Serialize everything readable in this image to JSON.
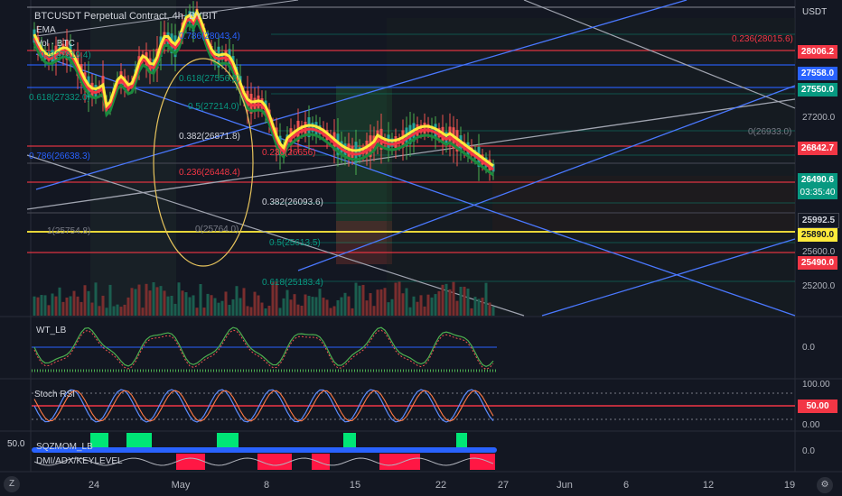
{
  "header": {
    "symbol": "BTCUSDT Perpetual Contract, 4h, BYBIT",
    "ema_label": "EMA",
    "vol_label": "Vol · BTC"
  },
  "currency": "USDT",
  "price_axis": [
    "27200.0",
    "25600.0",
    "25200.0"
  ],
  "price_tags": {
    "p28006": "28006.2",
    "p27558": "27558.0",
    "p27550": "27550.0",
    "p26842": "26842.7",
    "current": "26490.6",
    "countdown": "03:35:40",
    "p25992": "25992.5",
    "p25890": "25890.0",
    "p25490": "25490.0"
  },
  "fib_labels": {
    "f0236_top": "0.236(28015.6)",
    "f0786_a": "0.786(28043.4)",
    "f05_a": "0.5(27819.4)",
    "f0618_a": "0.618(27556.2)",
    "f0618_b": "0.618(27332.0)",
    "f05_b": "0.5(27214.0)",
    "f0382_a": "0.382(26871.8)",
    "f0786_b": "0.786(26638.3)",
    "f0236_a": "0.236(26448.4)",
    "f0236_b": "0.236(26656)",
    "f0_right": "0(26933.0)",
    "f0382_b": "0.382(26093.6)",
    "f1_left": "1(25754.8)",
    "f0_mid": "0(25764.0)",
    "f05_c": "0.5(25613.5)",
    "f0618_c": "0.618(25183.4)"
  },
  "indicators": {
    "wt_label": "WT_LB",
    "wt_zero": "0.0",
    "stoch_label": "Stoch RSI",
    "stoch_top": "100.00",
    "stoch_mid": "50.00",
    "stoch_bot": "0.00",
    "sqz_label": "SQZMOM_LB",
    "sqz_zero": "0.0",
    "dmi_label": "DMI/ADX/KEYLEVEL",
    "left_value": "50.0"
  },
  "time_axis": [
    "24",
    "May",
    "8",
    "15",
    "22",
    "27",
    "Jun",
    "6",
    "12",
    "19"
  ],
  "corner": {
    "left_btn": "Z",
    "right_btn": "⚙"
  },
  "colors": {
    "background": "#131722",
    "yellow": "#ffeb3b",
    "red": "#f23645",
    "blue": "#2962ff",
    "green": "#089981",
    "gray": "#787b86"
  }
}
